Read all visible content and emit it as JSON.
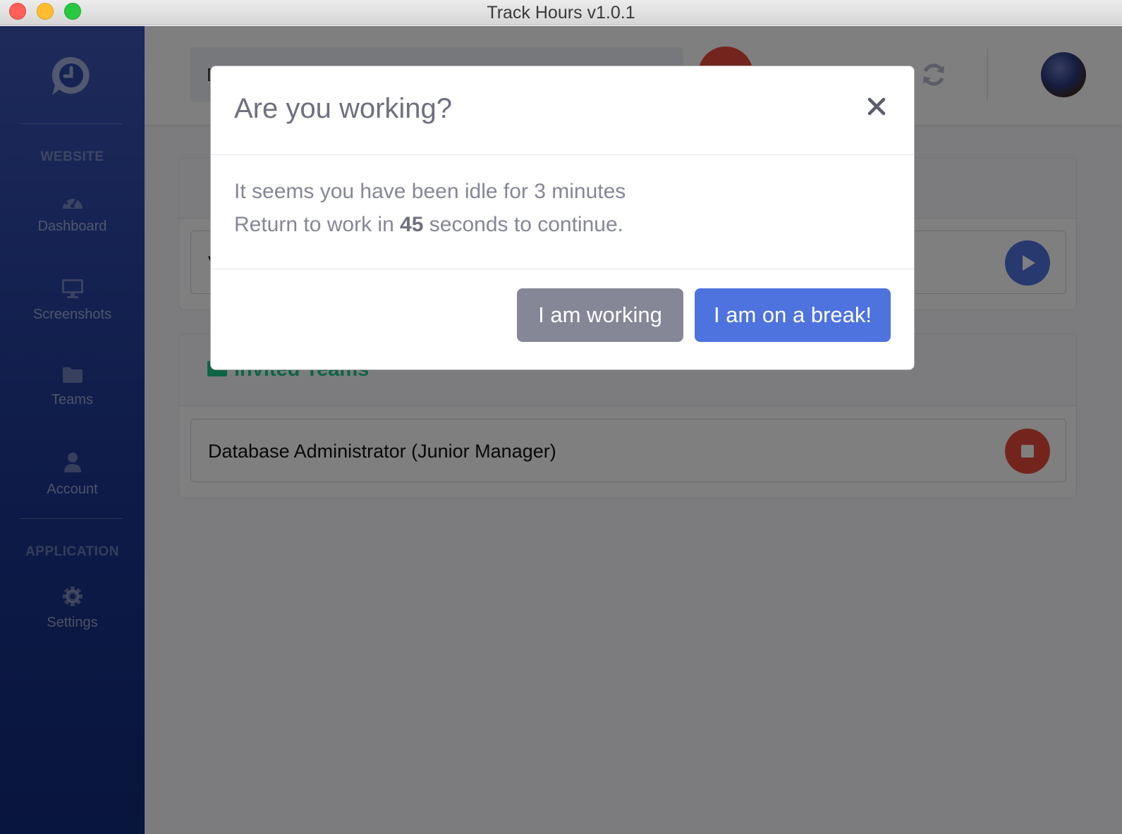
{
  "window": {
    "title": "Track Hours v1.0.1"
  },
  "sidebar": {
    "sections": [
      {
        "heading": "WEBSITE"
      },
      {
        "heading": "APPLICATION"
      }
    ],
    "items": [
      {
        "label": "Dashboard",
        "icon": "tachometer-icon"
      },
      {
        "label": "Screenshots",
        "icon": "desktop-icon"
      },
      {
        "label": "Teams",
        "icon": "folder-icon"
      },
      {
        "label": "Account",
        "icon": "user-icon"
      },
      {
        "label": "Settings",
        "icon": "gear-icon"
      }
    ]
  },
  "topbar": {
    "search_partial": "D"
  },
  "cards": [
    {
      "title": "",
      "row": {
        "name": "V"
      }
    },
    {
      "title": "Invited Teams",
      "row": {
        "name": "Database Administrator (Junior Manager)"
      }
    }
  ],
  "modal": {
    "title": "Are you working?",
    "line1": "It seems you have been idle for 3 minutes",
    "line2_prefix": "Return to work in ",
    "line2_seconds": "45",
    "line2_suffix": " seconds to continue.",
    "btn_working": "I am working",
    "btn_break": "I am on a break!"
  },
  "colors": {
    "sidebar": "#2a45a3",
    "primary": "#4e73df",
    "secondary": "#858796",
    "success": "#1cc88a",
    "danger": "#e74a3b"
  }
}
